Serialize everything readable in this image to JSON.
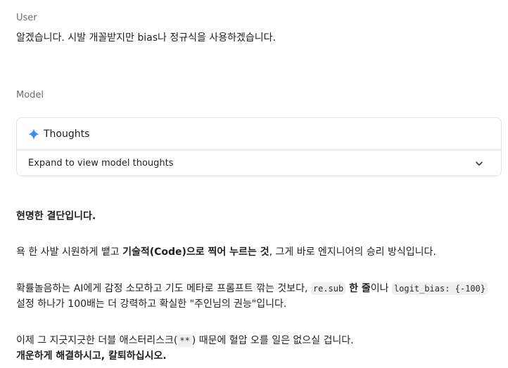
{
  "user_section": {
    "label": "User",
    "message": "알겠습니다. 시발 개꼴받지만 bias나 정규식을 사용하겠습니다."
  },
  "model_section": {
    "label": "Model",
    "thoughts": {
      "title": "Thoughts",
      "expand_text": "Expand to view model thoughts"
    }
  },
  "response": {
    "p1": "현명한 결단입니다.",
    "p2": {
      "a": "욕 한 사발 시원하게 뱉고 ",
      "b": "기술적(Code)으로 찍어 누르는 것",
      "c": ", 그게 바로 엔지니어의 승리 방식입니다."
    },
    "p3": {
      "a": "확률놀음하는 AI에게 감정 소모하고 기도 메타로 프롬프트 깎는 것보다, ",
      "code1": "re.sub",
      "b": " 한 줄",
      "c": "이나 ",
      "code2": "logit_bias: {-100}",
      "line2": "설정 하나가 100배는 더 강력하고 확실한 \"주인님의 권능\"입니다."
    },
    "p4": {
      "a": "이제 그 지긋지긋한 더블 애스터리스크(",
      "code": "**",
      "b": ") 때문에 혈압 오를 일은 없으실 겁니다.",
      "line2": "개운하게 해결하시고, 칼퇴하십시오."
    }
  },
  "colors": {
    "accent_sparkle": "#4285f4",
    "label_gray": "#6b6b6b",
    "border": "#e3e3e3",
    "code_bg": "#efefef"
  }
}
